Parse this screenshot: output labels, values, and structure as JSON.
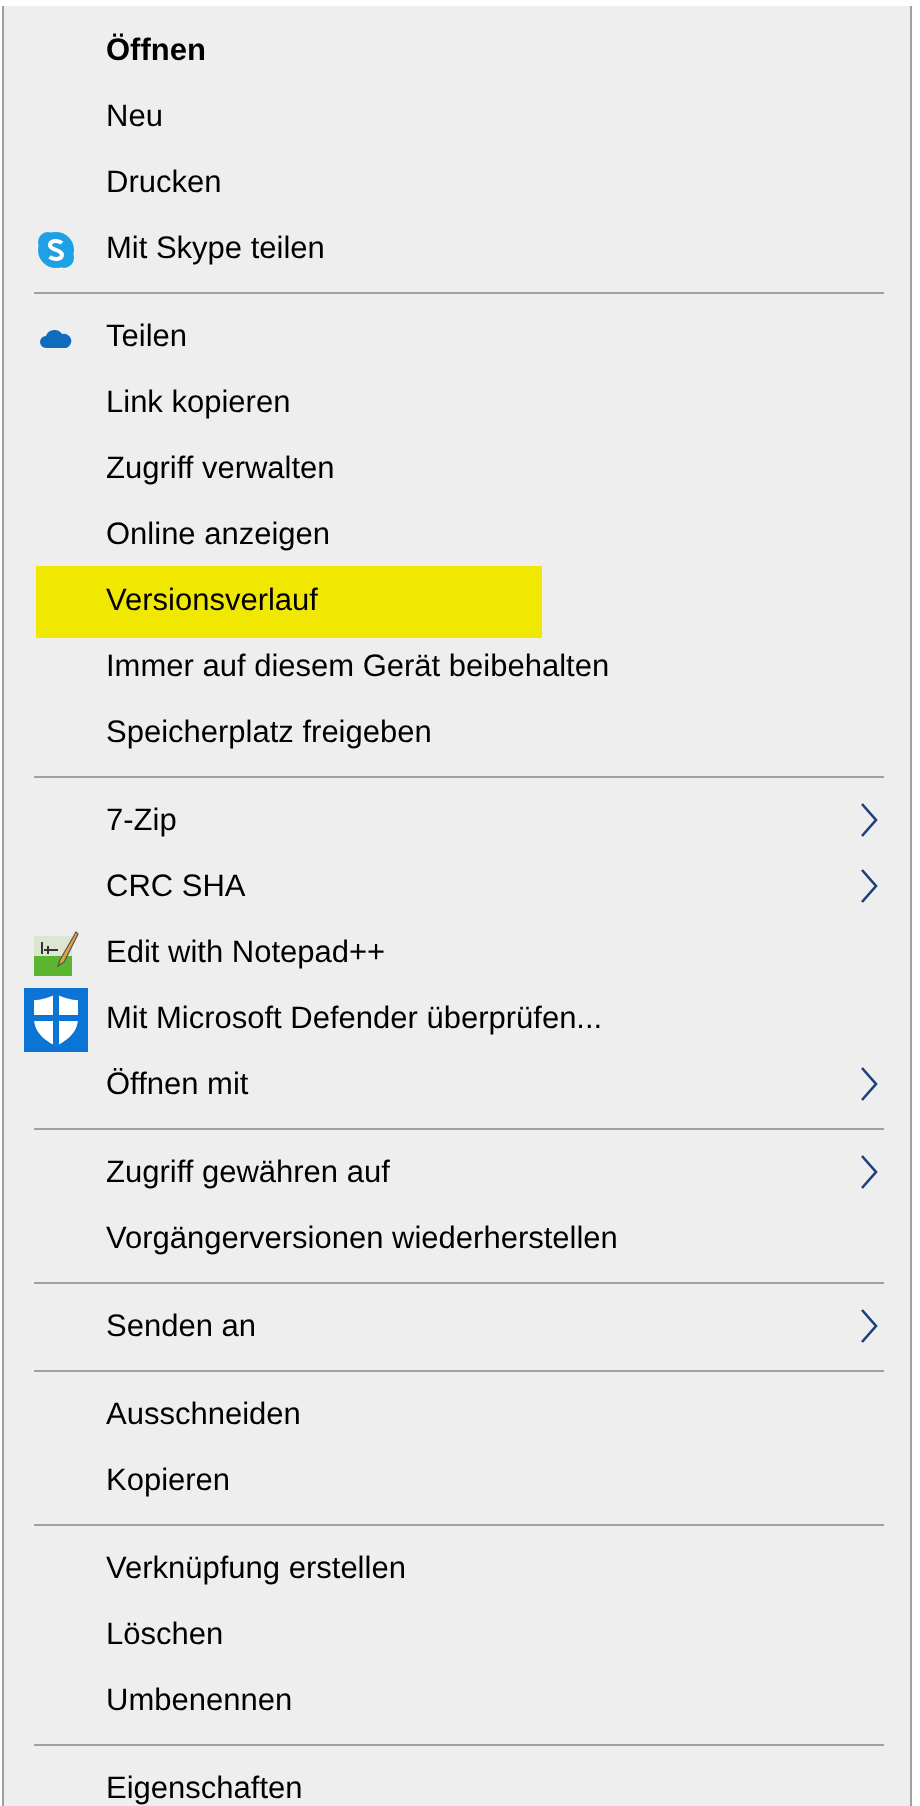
{
  "menu": {
    "groups": [
      [
        {
          "label": "Öffnen",
          "kind": "default",
          "highlighted": false
        },
        {
          "label": "Neu",
          "kind": "plain",
          "highlighted": false
        },
        {
          "label": "Drucken",
          "kind": "plain",
          "highlighted": false
        },
        {
          "label": "Mit Skype teilen",
          "kind": "skype",
          "highlighted": false
        }
      ],
      [
        {
          "label": "Teilen",
          "kind": "cloud",
          "highlighted": false
        },
        {
          "label": "Link kopieren",
          "kind": "plain",
          "highlighted": false
        },
        {
          "label": "Zugriff verwalten",
          "kind": "plain",
          "highlighted": false
        },
        {
          "label": "Online anzeigen",
          "kind": "plain",
          "highlighted": false
        },
        {
          "label": "Versionsverlauf",
          "kind": "plain",
          "highlighted": true
        },
        {
          "label": "Immer auf diesem Gerät beibehalten",
          "kind": "plain",
          "highlighted": false
        },
        {
          "label": "Speicherplatz freigeben",
          "kind": "plain",
          "highlighted": false
        }
      ],
      [
        {
          "label": "7-Zip",
          "kind": "submenu",
          "highlighted": false
        },
        {
          "label": "CRC SHA",
          "kind": "submenu",
          "highlighted": false
        },
        {
          "label": "Edit with Notepad++",
          "kind": "notepad",
          "highlighted": false
        },
        {
          "label": "Mit Microsoft Defender überprüfen...",
          "kind": "shield",
          "highlighted": false
        },
        {
          "label": "Öffnen mit",
          "kind": "submenu",
          "highlighted": false
        }
      ],
      [
        {
          "label": "Zugriff gewähren auf",
          "kind": "submenu",
          "highlighted": false
        },
        {
          "label": "Vorgängerversionen wiederherstellen",
          "kind": "plain",
          "highlighted": false
        }
      ],
      [
        {
          "label": "Senden an",
          "kind": "submenu",
          "highlighted": false
        }
      ],
      [
        {
          "label": "Ausschneiden",
          "kind": "plain",
          "highlighted": false
        },
        {
          "label": "Kopieren",
          "kind": "plain",
          "highlighted": false
        }
      ],
      [
        {
          "label": "Verknüpfung erstellen",
          "kind": "plain",
          "highlighted": false
        },
        {
          "label": "Löschen",
          "kind": "plain",
          "highlighted": false
        },
        {
          "label": "Umbenennen",
          "kind": "plain",
          "highlighted": false
        }
      ],
      [
        {
          "label": "Eigenschaften",
          "kind": "plain",
          "highlighted": false
        }
      ]
    ]
  }
}
